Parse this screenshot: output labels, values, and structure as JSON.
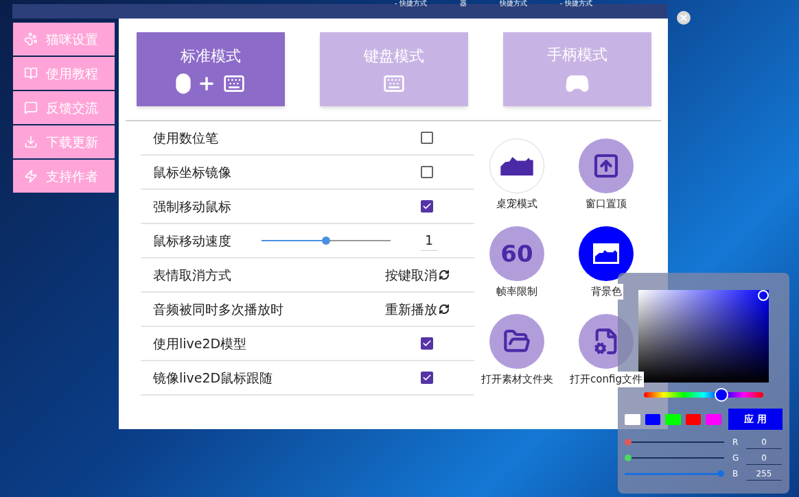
{
  "desktop_labels": [
    "- 快捷方式",
    "器",
    "快捷方式",
    "- 快捷方式"
  ],
  "sidebar": {
    "items": [
      {
        "label": "猫咪设置"
      },
      {
        "label": "使用教程"
      },
      {
        "label": "反馈交流"
      },
      {
        "label": "下载更新"
      },
      {
        "label": "支持作者"
      }
    ]
  },
  "modes": [
    {
      "label": "标准模式",
      "selected": true
    },
    {
      "label": "键盘模式",
      "selected": false
    },
    {
      "label": "手柄模式",
      "selected": false
    }
  ],
  "settings": [
    {
      "kind": "checkbox",
      "label": "使用数位笔",
      "checked": false
    },
    {
      "kind": "checkbox",
      "label": "鼠标坐标镜像",
      "checked": false
    },
    {
      "kind": "checkbox",
      "label": "强制移动鼠标",
      "checked": true
    },
    {
      "kind": "slider",
      "label": "鼠标移动速度",
      "level": 0.5,
      "value": "1"
    },
    {
      "kind": "cycle",
      "label": "表情取消方式",
      "value": "按键取消"
    },
    {
      "kind": "cycle",
      "label": "音频被同时多次播放时",
      "value": "重新播放"
    },
    {
      "kind": "checkbox",
      "label": "使用live2D模型",
      "checked": true
    },
    {
      "kind": "checkbox",
      "label": "镜像live2D鼠标跟随",
      "checked": true
    }
  ],
  "quick_buttons": [
    {
      "kind": "toggle",
      "label": "桌宠模式",
      "on": false
    },
    {
      "kind": "toggle",
      "label": "窗口置顶",
      "on": true
    },
    {
      "kind": "toggle",
      "label": "帧率限制",
      "icon_text": "60",
      "on": true
    },
    {
      "kind": "color",
      "label": "背景色",
      "color": "#0000ff"
    },
    {
      "kind": "action",
      "label": "打开素材文件夹"
    },
    {
      "kind": "action",
      "label": "打开config文件"
    }
  ],
  "color_picker": {
    "hue": {
      "level": 0.65
    },
    "swatches": [
      {
        "color": "#ffffff"
      },
      {
        "color": "#0000ff"
      },
      {
        "color": "#00ff00"
      },
      {
        "color": "#ff0000"
      },
      {
        "color": "#ff00ff"
      }
    ],
    "apply_button": "应 用",
    "channels": [
      {
        "name": "R",
        "value": "0",
        "level": 0,
        "color": "#e05a5a"
      },
      {
        "name": "G",
        "value": "0",
        "level": 0,
        "color": "#4cd964"
      },
      {
        "name": "B",
        "value": "255",
        "level": 1,
        "color": "#1a6fe0"
      }
    ]
  }
}
